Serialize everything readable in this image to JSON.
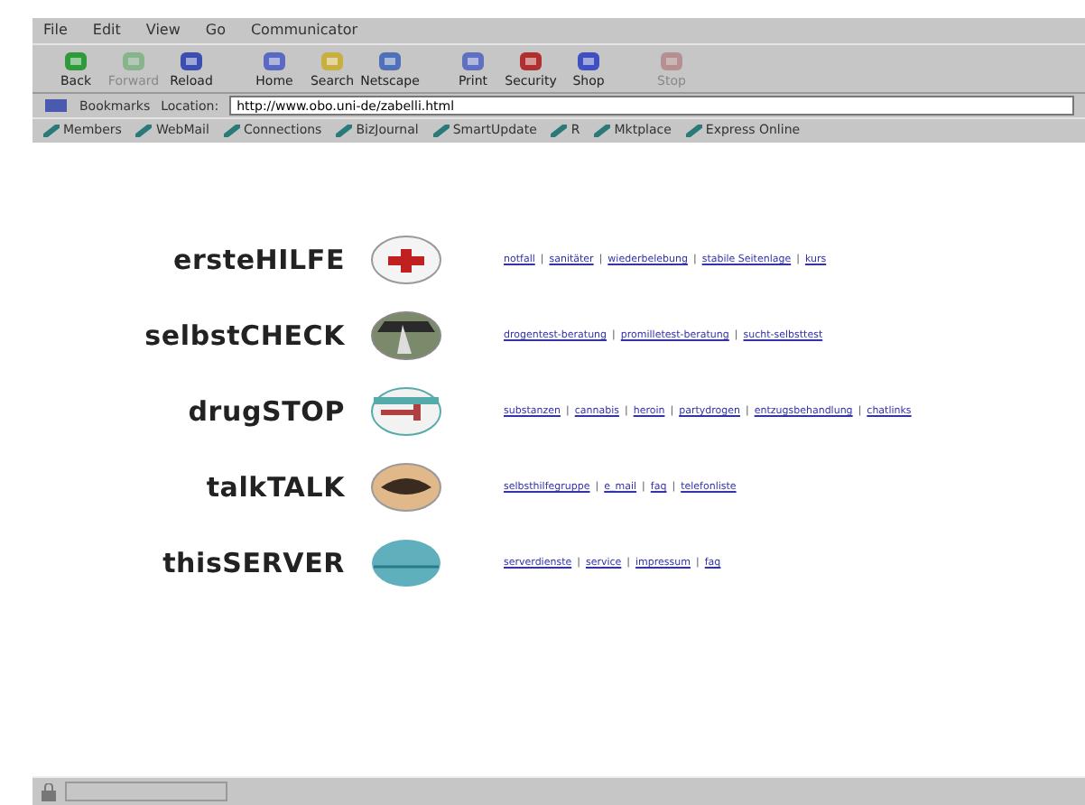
{
  "menu": [
    "File",
    "Edit",
    "View",
    "Go",
    "Communicator"
  ],
  "toolbar": [
    {
      "label": "Back",
      "disabled": false
    },
    {
      "label": "Forward",
      "disabled": true
    },
    {
      "label": "Reload",
      "disabled": false
    },
    {
      "label": "Home",
      "disabled": false
    },
    {
      "label": "Search",
      "disabled": false
    },
    {
      "label": "Netscape",
      "disabled": false
    },
    {
      "label": "Print",
      "disabled": false
    },
    {
      "label": "Security",
      "disabled": false
    },
    {
      "label": "Shop",
      "disabled": false
    },
    {
      "label": "Stop",
      "disabled": true
    }
  ],
  "location": {
    "bookmarks": "Bookmarks",
    "label": "Location:",
    "url": "http://www.obo.uni-de/zabelli.html"
  },
  "personal": [
    "Members",
    "WebMail",
    "Connections",
    "BizJournal",
    "SmartUpdate",
    "R",
    "Mktplace",
    "Express Online"
  ],
  "sections": [
    {
      "title": "ersteHILFE",
      "kind": "cross",
      "separator": "|",
      "links": [
        "notfall",
        "sanitäter",
        "wiederbelebung",
        "stabile Seitenlage",
        "kurs"
      ]
    },
    {
      "title": "selbstCHECK",
      "kind": "photo",
      "separator": "|",
      "links": [
        "drogentest-beratung",
        "promilletest-beratung",
        "sucht-selbsttest"
      ]
    },
    {
      "title": "drugSTOP",
      "kind": "syringe",
      "separator": "|",
      "links": [
        "substanzen",
        "cannabis",
        "heroin",
        "partydrogen",
        "entzugsbehandlung",
        "chatlinks"
      ]
    },
    {
      "title": "talkTALK",
      "kind": "eye",
      "separator": "|",
      "links": [
        "selbsthilfegruppe",
        "e_mail",
        "faq",
        "telefonliste"
      ]
    },
    {
      "title": "thisSERVER",
      "kind": "plain",
      "separator": "|",
      "links": [
        "serverdienste",
        "service",
        "impressum",
        "faq"
      ]
    }
  ]
}
